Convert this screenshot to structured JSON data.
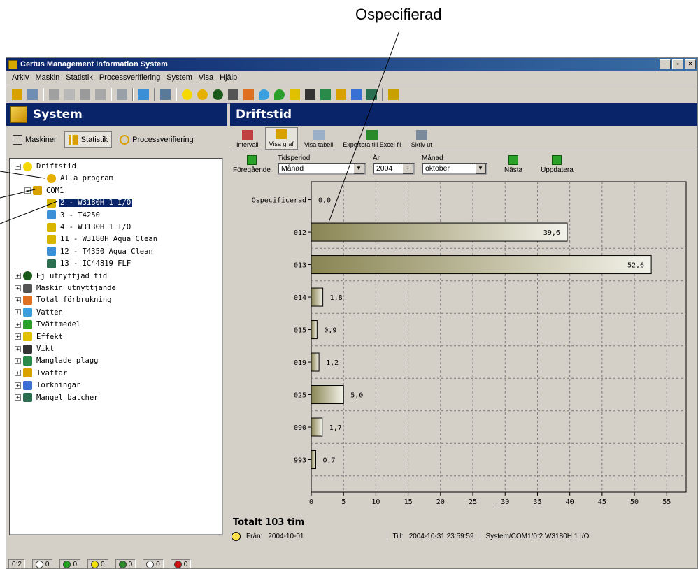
{
  "callout": {
    "title": "Ospecifierad"
  },
  "window": {
    "title": "Certus Management Information System",
    "buttons": [
      "_",
      "▫",
      "×"
    ]
  },
  "menu": [
    "Arkiv",
    "Maskin",
    "Statistik",
    "Processverifiering",
    "System",
    "Visa",
    "Hjälp"
  ],
  "left": {
    "header": "System",
    "tabs": [
      {
        "label": "Maskiner",
        "active": false
      },
      {
        "label": "Statistik",
        "active": true
      },
      {
        "label": "Processverifiering",
        "active": false
      }
    ],
    "tree": [
      {
        "label": "Driftstid",
        "level": 0,
        "expander": "−",
        "icon": "clock-icon",
        "color": "#f4d800"
      },
      {
        "label": "Alla program",
        "level": 2,
        "expander": "",
        "icon": "program-icon",
        "color": "#e6b000"
      },
      {
        "label": "COM1",
        "level": 1,
        "expander": "−",
        "icon": "network-icon",
        "color": "#d9a100"
      },
      {
        "label": "2 - W3180H 1 I/O",
        "level": 2,
        "expander": "",
        "icon": "washer-icon",
        "color": "#d9b500",
        "selected": true
      },
      {
        "label": "3 - T4250",
        "level": 2,
        "expander": "",
        "icon": "dryer-icon",
        "color": "#3a8fd6"
      },
      {
        "label": "4 - W3130H 1 I/O",
        "level": 2,
        "expander": "",
        "icon": "washer-icon",
        "color": "#d9b500"
      },
      {
        "label": "11 - W3180H Aqua Clean",
        "level": 2,
        "expander": "",
        "icon": "washer-icon",
        "color": "#d9b500"
      },
      {
        "label": "12 - T4350 Aqua Clean",
        "level": 2,
        "expander": "",
        "icon": "dryer-icon",
        "color": "#3a8fd6"
      },
      {
        "label": "13 - IC44819 FLF",
        "level": 2,
        "expander": "",
        "icon": "ironer-icon",
        "color": "#2a6f4f"
      },
      {
        "label": "Ej utnyttjad tid",
        "level": 0,
        "expander": "+",
        "icon": "pie-icon",
        "color": "#1c5a1c"
      },
      {
        "label": "Maskin utnyttjande",
        "level": 0,
        "expander": "+",
        "icon": "grid-icon",
        "color": "#555555"
      },
      {
        "label": "Total förbrukning",
        "level": 0,
        "expander": "+",
        "icon": "calculator-icon",
        "color": "#e07020"
      },
      {
        "label": "Vatten",
        "level": 0,
        "expander": "+",
        "icon": "water-drop-icon",
        "color": "#3aa0e0"
      },
      {
        "label": "Tvättmedel",
        "level": 0,
        "expander": "+",
        "icon": "detergent-drop-icon",
        "color": "#2aa02a"
      },
      {
        "label": "Effekt",
        "level": 0,
        "expander": "+",
        "icon": "lightning-icon",
        "color": "#e0c000"
      },
      {
        "label": "Vikt",
        "level": 0,
        "expander": "+",
        "icon": "weight-icon",
        "color": "#333333"
      },
      {
        "label": "Manglade plagg",
        "level": 0,
        "expander": "+",
        "icon": "garment-icon",
        "color": "#2a8a4a"
      },
      {
        "label": "Tvättar",
        "level": 0,
        "expander": "+",
        "icon": "washes-icon",
        "color": "#d9a100"
      },
      {
        "label": "Torkningar",
        "level": 0,
        "expander": "+",
        "icon": "dryings-icon",
        "color": "#3a6fd6"
      },
      {
        "label": "Mangel batcher",
        "level": 0,
        "expander": "+",
        "icon": "batch-icon",
        "color": "#2a6f4f"
      }
    ]
  },
  "status": {
    "items": [
      {
        "text": "0:2",
        "color": ""
      },
      {
        "text": "0",
        "color": "#ffffff"
      },
      {
        "text": "0",
        "color": "#1fa01f"
      },
      {
        "text": "0",
        "color": "#f2e200"
      },
      {
        "text": "0",
        "color": "#2a8a2a"
      },
      {
        "text": "0",
        "color": "#ffffff"
      },
      {
        "text": "0",
        "color": "#d01010"
      }
    ]
  },
  "right": {
    "header": "Driftstid",
    "toolbar": [
      "Intervall",
      "Visa graf",
      "Visa tabell",
      "Exportera till Excel fil",
      "Skriv ut"
    ],
    "nav": {
      "prev": "Föregående",
      "next": "Nästa",
      "update": "Uppdatera",
      "period_label": "Tidsperiod",
      "period_value": "Månad",
      "year_label": "År",
      "year_value": "2004",
      "month_label": "Månad",
      "month_value": "oktober"
    },
    "summary": {
      "total": "Totalt 103 tim",
      "from_label": "Från:",
      "from_value": "2004-10-01",
      "to_label": "Till:",
      "to_value": "2004-10-31 23:59:59",
      "path": "System/COM1/0:2 W3180H 1 I/O"
    }
  },
  "chart_data": {
    "type": "bar",
    "orientation": "horizontal",
    "categories": [
      "Ospecificerad",
      "012",
      "013",
      "014",
      "015",
      "019",
      "025",
      "090",
      "993"
    ],
    "values": [
      0.0,
      39.6,
      52.6,
      1.8,
      0.9,
      1.2,
      5.0,
      1.7,
      0.7
    ],
    "value_labels": [
      "0,0",
      "39,6",
      "52,6",
      "1,8",
      "0,9",
      "1,2",
      "5,0",
      "1,7",
      "0,7"
    ],
    "xlabel": "Timmar",
    "xticks": [
      0,
      5,
      10,
      15,
      20,
      25,
      30,
      35,
      40,
      45,
      50,
      55
    ],
    "xlim": [
      0,
      58
    ],
    "grid": true
  }
}
